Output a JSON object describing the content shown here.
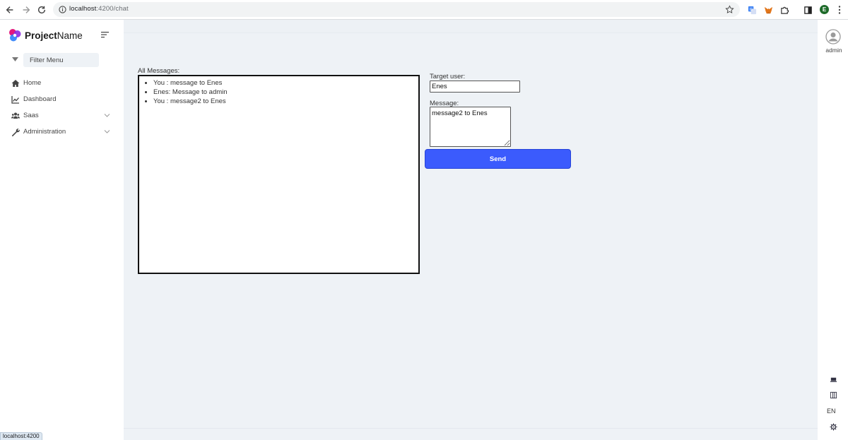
{
  "browser": {
    "url_host": "localhost",
    "url_path": ":4200/chat",
    "profile_initial": "E",
    "status_url": "localhost:4200"
  },
  "sidebar": {
    "brand_bold": "Project",
    "brand_rest": "Name",
    "filter_placeholder": "Filter Menu",
    "items": [
      {
        "label": "Home",
        "icon": "home-icon"
      },
      {
        "label": "Dashboard",
        "icon": "chart-line-icon"
      },
      {
        "label": "Saas",
        "icon": "users-icon",
        "expandable": true
      },
      {
        "label": "Administration",
        "icon": "wrench-icon",
        "expandable": true
      }
    ]
  },
  "chat": {
    "all_messages_label": "All Messages:",
    "messages": [
      "You : message to Enes",
      "Enes: Message to admin",
      "You : message2 to Enes"
    ],
    "target_label": "Target user:",
    "target_value": "Enes",
    "message_label": "Message:",
    "message_value": "message2 to Enes",
    "send_label": "Send"
  },
  "rail": {
    "user_label": "admin",
    "language": "EN"
  },
  "colors": {
    "primary": "#3b5bfd",
    "background": "#eef2f6",
    "profile": "#1e6b2a"
  }
}
